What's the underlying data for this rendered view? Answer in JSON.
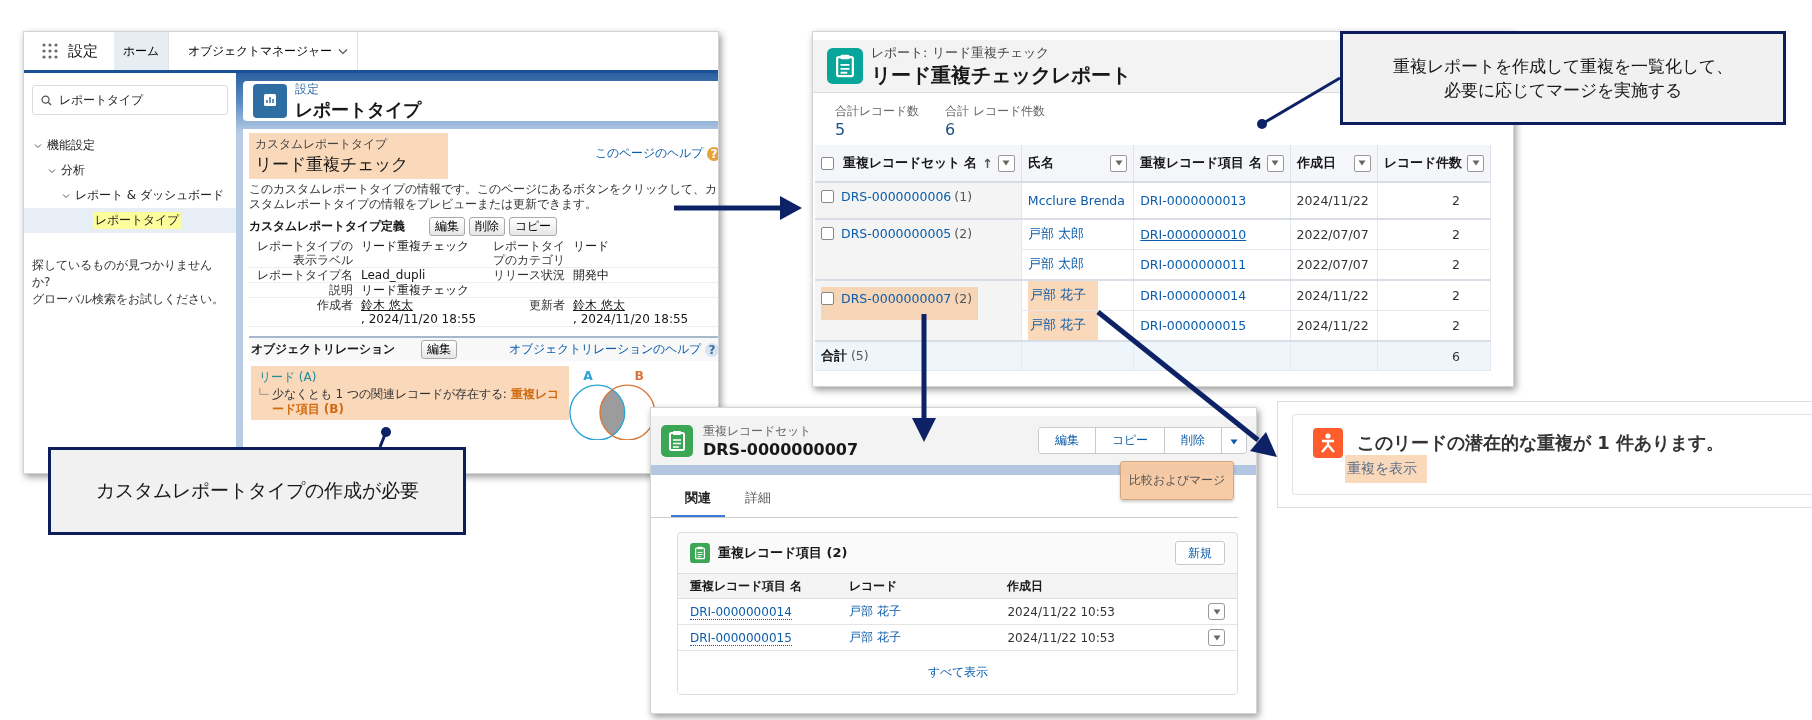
{
  "setup_screen": {
    "app_name": "設定",
    "tabs": [
      {
        "label": "ホーム",
        "selected": true,
        "menu": false
      },
      {
        "label": "オブジェクトマネージャー",
        "selected": false,
        "menu": true
      }
    ],
    "search": {
      "value": "レポートタイプ"
    },
    "tree": [
      {
        "label": "機能設定",
        "selected": false,
        "expanded": true,
        "children": [
          {
            "label": "分析",
            "selected": false,
            "expanded": true,
            "children": [
              {
                "label": "レポート & ダッシュボード",
                "selected": false,
                "expanded": true,
                "children": [
                  {
                    "label": "レポートタイプ",
                    "selected": true
                  }
                ]
              }
            ]
          }
        ]
      }
    ],
    "help_text": [
      "探しているものが見つかりませんか?",
      "グローバル検索をお試しください。"
    ],
    "header": {
      "eyebrow": "設定",
      "title": "レポートタイプ"
    },
    "report_type": {
      "eyebrow": "カスタムレポートタイプ",
      "title": "リード重複チェック",
      "highlighted": true
    },
    "help_link": "このページのヘルプ",
    "help_mark": "?",
    "description": "このカスタムレポートタイプの情報です。このページにあるボタンをクリックして、カスタムレポートタイプの情報をプレビューまたは更新できます。",
    "definition": {
      "title": "カスタムレポートタイプ定義",
      "buttons": [
        "編集",
        "削除",
        "コピー"
      ],
      "rows": [
        [
          {
            "label": "レポートタイプの表示ラベル",
            "value": "リード重複チェック"
          },
          {
            "label": "レポートタイプのカテゴリ",
            "value": "リード"
          }
        ],
        [
          {
            "label": "レポートタイプ名",
            "value": "Lead_dupli"
          },
          {
            "label": "リリース状況",
            "value": "開発中"
          }
        ],
        [
          {
            "label": "説明",
            "value": "リード重複チェック"
          }
        ],
        [
          {
            "label": "作成者",
            "user": "鈴木 悠太",
            "value": ", 2024/11/20 18:55"
          },
          {
            "label": "更新者",
            "user": "鈴木 悠太",
            "value": ", 2024/11/20 18:55"
          }
        ]
      ]
    },
    "relation": {
      "title": "オブジェクトリレーション",
      "button": "編集",
      "help_link": "オブジェクトリレーションのヘルプ",
      "help_mark": "?",
      "primary": "リード (A)",
      "condition": "少なくとも 1 つの関連レコードが存在する: ",
      "target": "重複レコード項目 (B)",
      "highlighted": true,
      "venn_labels": [
        "A",
        "B"
      ]
    }
  },
  "report_screen": {
    "breadcrumb": "レポート: リード重複チェック",
    "title": "リード重複チェックレポート",
    "summary": [
      {
        "label": "合計レコード数",
        "value": "5"
      },
      {
        "label": "合計 レコード件数",
        "value": "6"
      }
    ],
    "header_checked": false,
    "sort_mark": "↑",
    "columns": [
      "重複レコードセット 名",
      "氏名",
      "重複レコード項目 名",
      "作成日",
      "レコード件数"
    ],
    "groups": [
      {
        "set": "DRS-0000000006",
        "count": "(1)",
        "checked": false,
        "highlighted": false,
        "records": [
          {
            "name": "Mcclure Brenda",
            "item": "DRI-0000000013",
            "date": "2024/11/22",
            "count": "2",
            "highlighted": false,
            "hovered": false
          }
        ]
      },
      {
        "set": "DRS-0000000005",
        "count": "(2)",
        "checked": false,
        "highlighted": false,
        "records": [
          {
            "name": "戸部 太郎",
            "item": "DRI-0000000010",
            "date": "2022/07/07",
            "count": "2",
            "highlighted": false,
            "hovered": true
          },
          {
            "name": "戸部 太郎",
            "item": "DRI-0000000011",
            "date": "2022/07/07",
            "count": "2",
            "highlighted": false,
            "hovered": false
          }
        ]
      },
      {
        "set": "DRS-0000000007",
        "count": "(2)",
        "checked": false,
        "highlighted": true,
        "records": [
          {
            "name": "戸部 花子",
            "item": "DRI-0000000014",
            "date": "2024/11/22",
            "count": "2",
            "highlighted": true,
            "hovered": false
          },
          {
            "name": "戸部 花子",
            "item": "DRI-0000000015",
            "date": "2024/11/22",
            "count": "2",
            "highlighted": true,
            "hovered": false
          }
        ]
      }
    ],
    "total": {
      "label": "合計",
      "count": "(5)",
      "value": "6"
    }
  },
  "record_screen": {
    "eyebrow": "重複レコードセット",
    "title": "DRS-0000000007",
    "actions": [
      "編集",
      "コピー",
      "削除"
    ],
    "menu": [
      {
        "label": "比較およびマージ",
        "highlighted": true
      }
    ],
    "tabs": [
      {
        "label": "関連",
        "selected": true
      },
      {
        "label": "詳細",
        "selected": false
      }
    ],
    "related": {
      "title": "重複レコード項目 (2)",
      "button": "新規",
      "columns": [
        "重複レコード項目 名",
        "レコード",
        "作成日"
      ],
      "rows": [
        {
          "item": "DRI-0000000014",
          "record": "戸部 花子",
          "created": "2024/11/22 10:53"
        },
        {
          "item": "DRI-0000000015",
          "record": "戸部 花子",
          "created": "2024/11/22 10:53"
        }
      ],
      "footer_link": "すべて表示"
    }
  },
  "duplicate_alert": {
    "message": "このリードの潜在的な重複が 1 件あります。",
    "link": "重複を表示",
    "highlighted": true
  },
  "callouts": [
    {
      "lines": [
        "重複レポートを作成して重複を一覧化して、",
        "必要に応じてマージを実施する"
      ]
    },
    {
      "lines": [
        "カスタムレポートタイプの作成が必要"
      ]
    }
  ]
}
